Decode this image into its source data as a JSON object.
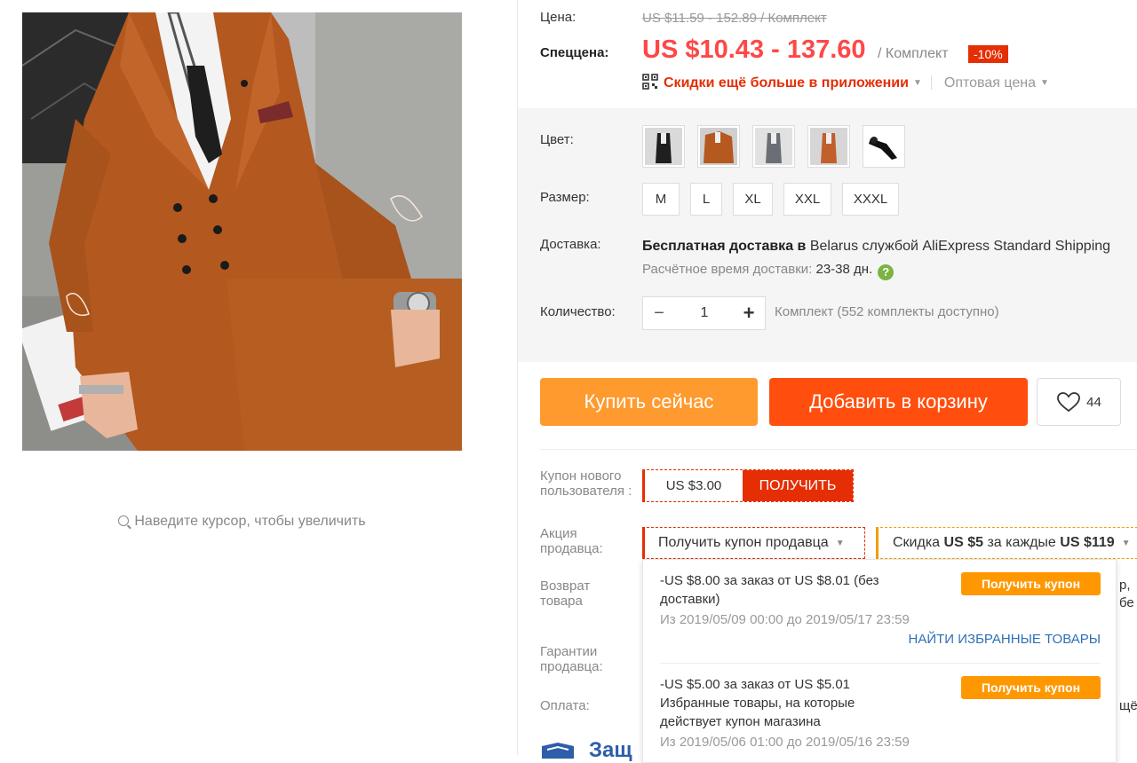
{
  "gallery": {
    "zoom_hint": "Наведите курсор, чтобы увеличить"
  },
  "price": {
    "label": "Цена:",
    "old": "US $11.59 - 152.89 / Комплект",
    "special_label": "Спеццена:",
    "new": "US $10.43 - 137.60",
    "unit": "/ Комплект",
    "discount": "-10%",
    "app_discount": "Скидки ещё больше в приложении",
    "wholesale": "Оптовая цена"
  },
  "color": {
    "label": "Цвет:",
    "swatches": [
      "black-suit",
      "orange-suit",
      "gray-suit",
      "orange-suit-2",
      "tie"
    ]
  },
  "size": {
    "label": "Размер:",
    "options": [
      "M",
      "L",
      "XL",
      "XXL",
      "XXXL"
    ]
  },
  "shipping": {
    "label": "Доставка:",
    "free": "Бесплатная доставка в",
    "country_service": "Belarus службой AliExpress Standard Shipping",
    "eta_label": "Расчётное время доставки:",
    "eta_days": "23-38 дн.",
    "help_icon": "?"
  },
  "quantity": {
    "label": "Количество:",
    "minus": "−",
    "value": "1",
    "plus": "+",
    "available": "Комплект (552 комплекты доступно)"
  },
  "actions": {
    "buy_now": "Купить сейчас",
    "add_to_cart": "Добавить в корзину",
    "wishlist_count": "44"
  },
  "new_user_coupon": {
    "label": "Купон нового пользователя :",
    "amount": "US $3.00",
    "get": "ПОЛУЧИТЬ"
  },
  "seller_promo": {
    "label": "Акция продавца:",
    "coupon_dropdown": "Получить купон продавца",
    "discount_prefix": "Скидка",
    "discount_amount": "US $5",
    "discount_middle": "за каждые",
    "discount_threshold": "US $119"
  },
  "returns": {
    "label": "Возврат товара"
  },
  "guarantees": {
    "label": "Гарантии продавца:"
  },
  "payment": {
    "label": "Оплата:"
  },
  "behind_text": {
    "line1": "р,",
    "line2": "бе и",
    "line3": "щё"
  },
  "protection": {
    "text": "Защ"
  },
  "coupon_dropdown": {
    "items": [
      {
        "title": "-US $8.00 за заказ от US $8.01 (без доставки)",
        "dates": "Из 2019/05/09 00:00 до 2019/05/17 23:59",
        "button": "Получить купон",
        "link": "НАЙТИ ИЗБРАННЫЕ ТОВАРЫ"
      },
      {
        "title": "-US $5.00 за заказ от US $5.01 Избранные товары, на которые действует купон магазина",
        "dates": "Из 2019/05/06 01:00 до 2019/05/16 23:59",
        "button": "Получить купон"
      }
    ]
  },
  "colors": {
    "accent_red": "#ff4747",
    "buy_orange": "#ff9a2e",
    "cart_orange": "#ff4e0d",
    "link_blue": "#2f6fb5"
  }
}
